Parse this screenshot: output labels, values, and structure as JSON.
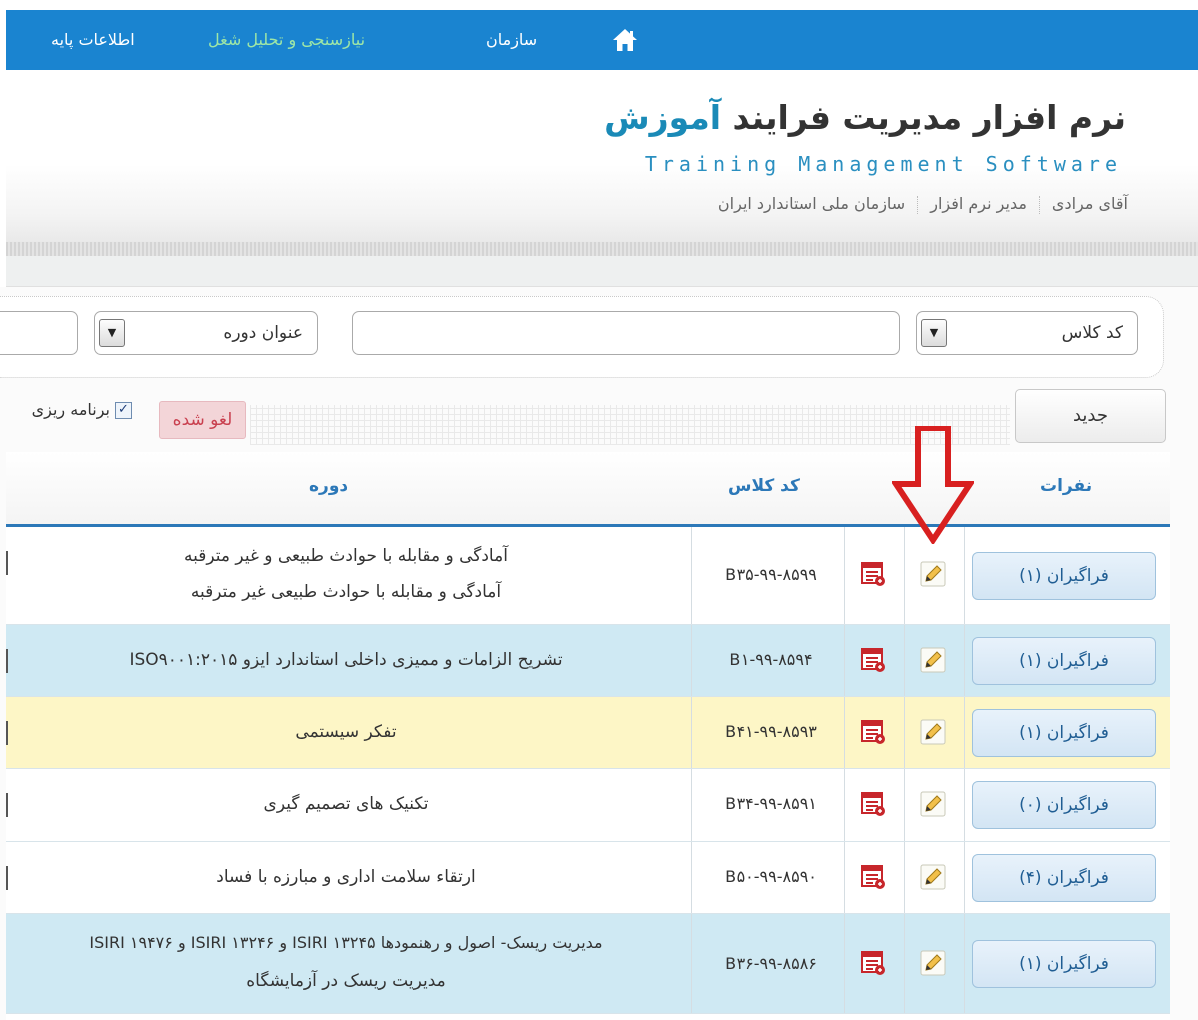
{
  "nav": {
    "items": [
      {
        "label": "اطلاعات پایه"
      },
      {
        "label": "نیازسنجی و تحلیل شغل"
      },
      {
        "label": "سازمان"
      }
    ],
    "home_icon": "home-icon"
  },
  "header": {
    "title_main": "نرم افزار مدیریت فرایند ",
    "title_highlight": "آموزش",
    "subtitle": "Training Management Software",
    "user": "آقای مرادی",
    "role": "مدیر نرم افزار",
    "organization": "سازمان ملی استاندارد ایران"
  },
  "filters": {
    "field1_label": "کد کلاس",
    "field2_label": "عنوان دوره",
    "dropdown_arrow": "▼"
  },
  "toolbar": {
    "new_label": "جدید",
    "cancelled_label": "لغو شده",
    "planning_label": "برنامه ریزی",
    "check_mark": "✓"
  },
  "table": {
    "headers": {
      "learners": "نفرات",
      "class_code": "کد کلاس",
      "course": "دوره"
    },
    "rows": [
      {
        "learners": "فراگیران (۱)",
        "code": "B۳۵-۹۹-۸۵۹۹",
        "title1": "آمادگی و مقابله با حوادث طبیعی و غیر مترقبه",
        "title2": "آمادگی و مقابله با حوادث طبیعی غیر مترقبه"
      },
      {
        "learners": "فراگیران (۱)",
        "code": "B۱-۹۹-۸۵۹۴",
        "title1": "تشریح الزامات و ممیزی داخلی استاندارد ایزو ISO۹۰۰۱:۲۰۱۵",
        "title2": ""
      },
      {
        "learners": "فراگیران (۱)",
        "code": "B۴۱-۹۹-۸۵۹۳",
        "title1": "تفکر سیستمی",
        "title2": ""
      },
      {
        "learners": "فراگیران (۰)",
        "code": "B۳۴-۹۹-۸۵۹۱",
        "title1": "تکنیک های تصمیم گیری",
        "title2": ""
      },
      {
        "learners": "فراگیران (۴)",
        "code": "B۵۰-۹۹-۸۵۹۰",
        "title1": "ارتقاء سلامت اداری و مبارزه با فساد",
        "title2": ""
      },
      {
        "learners": "فراگیران (۱)",
        "code": "B۳۶-۹۹-۸۵۸۶",
        "title1": "مدیریت ریسک- اصول و رهنمودها ISIRI ۱۳۲۴۵ و ISIRI ۱۳۲۴۶ و ISIRI ۱۹۴۷۶",
        "title2": "مدیریت ریسک در آزمایشگاه"
      }
    ]
  },
  "colors": {
    "nav_bg": "#1a84d0",
    "accent": "#2c78b8",
    "row_blue": "#cfe9f3",
    "row_yellow": "#fdf6c6",
    "cancelled_bg": "#f3d5d8",
    "annotation_arrow": "#d82020"
  }
}
